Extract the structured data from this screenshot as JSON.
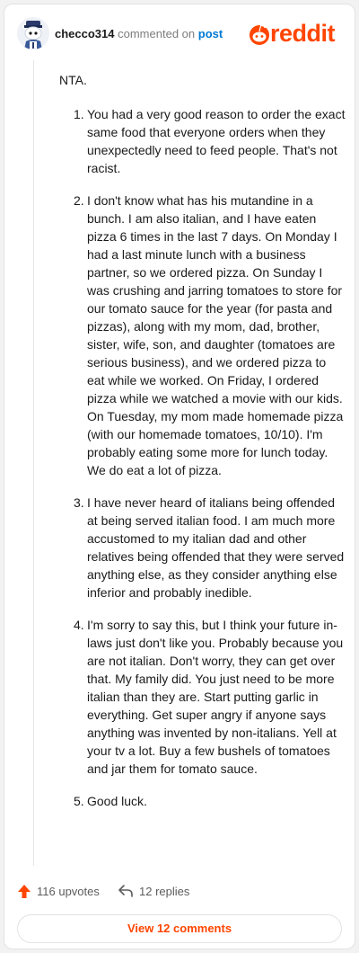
{
  "header": {
    "username": "checco314",
    "commented_on": "commented on",
    "post_link": "post",
    "brand": "reddit"
  },
  "comment": {
    "opening": "NTA.",
    "items": [
      {
        "num": "1.",
        "text": "You had a very good reason to order the exact same food that everyone orders when they unexpectedly need to feed people. That's not racist."
      },
      {
        "num": "2.",
        "text": "I don't know what has his mutandine in a bunch. I am also italian, and I have eaten pizza 6 times in the last 7 days. On Monday I had a last minute lunch with a business partner, so we ordered pizza. On Sunday I was crushing and jarring tomatoes to store for our tomato sauce for the year (for pasta and pizzas), along with my mom, dad, brother, sister, wife, son, and daughter (tomatoes are serious business), and we ordered pizza to eat while we worked. On Friday, I ordered pizza while we watched a movie with our kids. On Tuesday, my mom made homemade pizza (with our homemade tomatoes, 10/10). I'm probably eating some more for lunch today. We do eat a lot of pizza."
      },
      {
        "num": "3.",
        "text": "I have never heard of italians being offended at being served italian food. I am much more accustomed to my italian dad and other relatives being offended that they were served anything else, as they consider anything else inferior and probably inedible."
      },
      {
        "num": "4.",
        "text": "I'm sorry to say this, but I think your future in-laws just don't like you. Probably because you are not italian. Don't worry, they can get over that. My family did. You just need to be more italian than they are. Start putting garlic in everything. Get super angry if anyone says anything was invented by non-italians. Yell at your tv a lot. Buy a few bushels of tomatoes and jar them for tomato sauce."
      },
      {
        "num": "5.",
        "text": "Good luck."
      }
    ]
  },
  "footer": {
    "upvotes": "116 upvotes",
    "replies": "12 replies",
    "view_comments": "View 12 comments"
  },
  "colors": {
    "brand": "#ff4500",
    "link": "#0079d3"
  },
  "icons": [
    "avatar",
    "reddit-logo-icon",
    "upvote-arrow-icon",
    "reply-arrow-icon"
  ]
}
